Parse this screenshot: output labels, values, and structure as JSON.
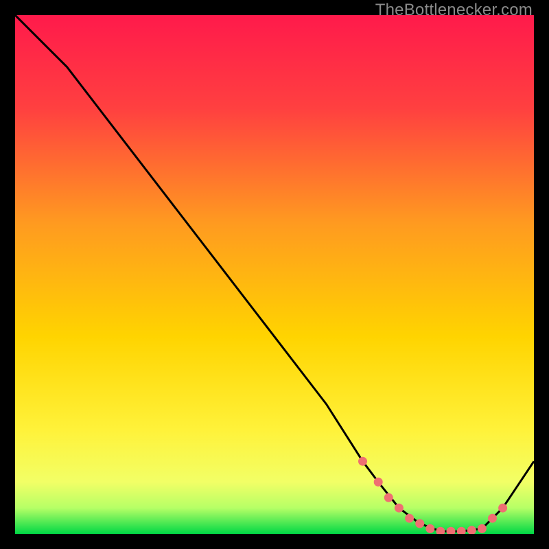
{
  "watermark": "TheBottlenecker.com",
  "colors": {
    "bg": "#000000",
    "grad_top": "#ff1a4b",
    "grad_mid1": "#ff6a2a",
    "grad_mid2": "#ffd400",
    "grad_low1": "#f6ff5a",
    "grad_low2": "#9cff66",
    "grad_bottom": "#00e04a",
    "curve": "#000000",
    "marker": "#ef6f72"
  },
  "chart_data": {
    "type": "line",
    "title": "",
    "xlabel": "",
    "ylabel": "",
    "xlim": [
      0,
      100
    ],
    "ylim": [
      0,
      100
    ],
    "series": [
      {
        "name": "bottleneck-curve",
        "x": [
          0,
          6,
          10,
          20,
          30,
          40,
          50,
          60,
          67,
          70,
          74,
          78,
          82,
          86,
          90,
          94,
          100
        ],
        "y": [
          100,
          94,
          90,
          77,
          64,
          51,
          38,
          25,
          14,
          10,
          5,
          2,
          0.5,
          0.5,
          1,
          5,
          14
        ]
      }
    ],
    "markers": {
      "name": "highlighted-region",
      "x": [
        67,
        70,
        72,
        74,
        76,
        78,
        80,
        82,
        84,
        86,
        88,
        90,
        92,
        94
      ],
      "y": [
        14,
        10,
        7,
        5,
        3,
        2,
        1,
        0.5,
        0.5,
        0.5,
        0.7,
        1,
        3,
        5
      ]
    }
  }
}
